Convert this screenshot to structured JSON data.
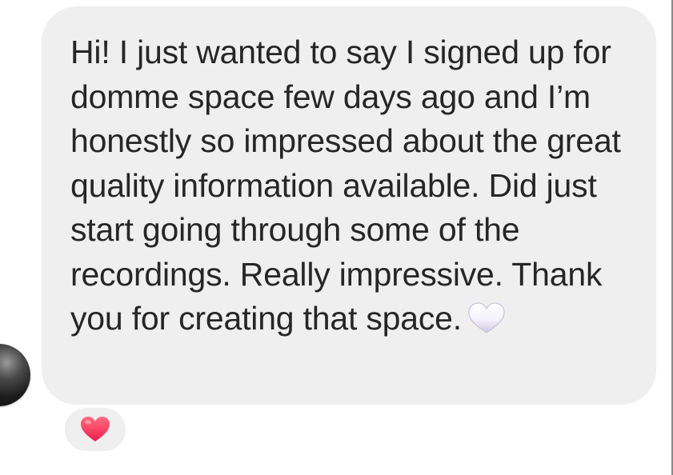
{
  "message": {
    "text": "Hi! I just wanted to say I signed up for domme space few days ago and I’m honestly so impressed about the great quality information available. Did just start going through some of the recordings. Really impressive. Thank you for creating that space.",
    "inline_emoji": "white-heart-icon",
    "bubble_color": "#efefef",
    "text_color": "#262626"
  },
  "reaction": {
    "emoji": "red-heart-icon",
    "color": "#ff3b5c"
  },
  "avatar": {
    "icon": "avatar"
  }
}
